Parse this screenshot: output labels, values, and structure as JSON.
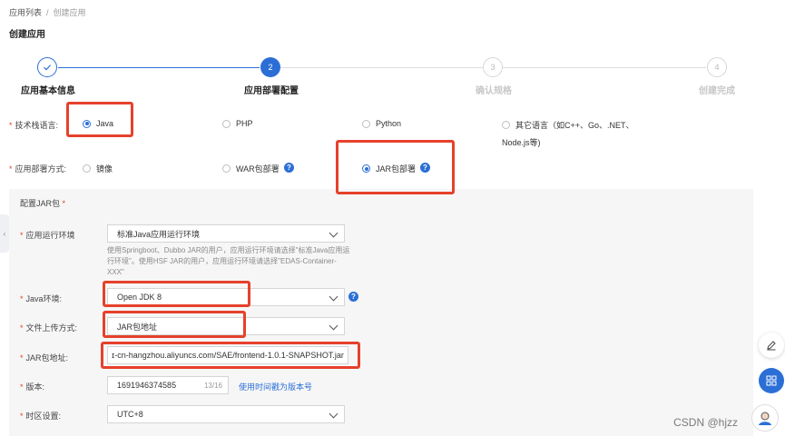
{
  "breadcrumb": {
    "root": "应用列表",
    "separator": "/",
    "current": "创建应用"
  },
  "page_title": "创建应用",
  "steps": [
    {
      "number": "",
      "label": "应用基本信息",
      "state": "done"
    },
    {
      "number": "2",
      "label": "应用部署配置",
      "state": "active"
    },
    {
      "number": "3",
      "label": "确认规格",
      "state": "todo"
    },
    {
      "number": "4",
      "label": "创建完成",
      "state": "todo"
    }
  ],
  "tech_stack": {
    "label": "技术栈语言:",
    "options": [
      "Java",
      "PHP",
      "Python",
      "其它语言（如C++、Go、.NET、",
      "Node.js等)"
    ],
    "selected": "Java"
  },
  "deploy_method": {
    "label": "应用部署方式:",
    "options": [
      "镜像",
      "WAR包部署",
      "JAR包部署"
    ],
    "selected": "JAR包部署"
  },
  "jar_section": {
    "title": "配置JAR包",
    "runtime": {
      "label": "应用运行环境",
      "value": "标准Java应用运行环境",
      "hint": "使用Springboot、Dubbo JAR的用户，应用运行环境请选择\"标准Java应用运行环境\"。使用HSF JAR的用户，应用运行环境请选择\"EDAS-Container-XXX\""
    },
    "java_env": {
      "label": "Java环境:",
      "value": "Open JDK 8"
    },
    "upload_method": {
      "label": "文件上传方式:",
      "value": "JAR包地址"
    },
    "jar_url": {
      "label": "JAR包地址:",
      "value": "ɪ-cn-hangzhou.aliyuncs.com/SAE/frontend-1.0.1-SNAPSHOT.jar"
    },
    "version": {
      "label": "版本:",
      "value": "1691946374585",
      "counter": "13/16",
      "link": "使用时间戳为版本号"
    },
    "timezone": {
      "label": "时区设置:",
      "value": "UTC+8"
    }
  },
  "watermark": "CSDN @hjzz",
  "colors": {
    "primary": "#2b6fd6",
    "highlight": "#e6412b",
    "required": "#e0462a"
  },
  "icons": [
    "check-icon",
    "help-icon",
    "chevron-down-icon",
    "edit-icon",
    "grid-icon",
    "avatar-icon"
  ]
}
